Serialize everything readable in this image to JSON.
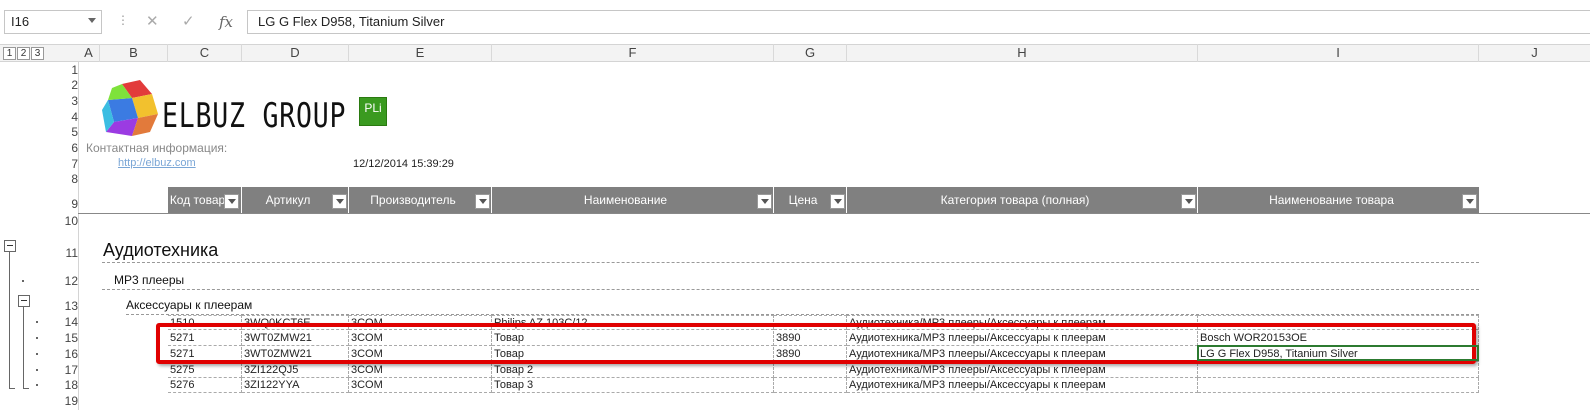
{
  "formula_bar": {
    "name_box": "I16",
    "cancel_icon": "✕",
    "enter_icon": "✓",
    "fx_icon": "fx",
    "formula": "LG G Flex D958, Titanium Silver"
  },
  "outline_levels": [
    "1",
    "2",
    "3"
  ],
  "columns": [
    "A",
    "B",
    "C",
    "D",
    "E",
    "F",
    "G",
    "H",
    "I",
    "J"
  ],
  "rows": [
    "1",
    "2",
    "3",
    "4",
    "5",
    "6",
    "7",
    "8",
    "9",
    "10",
    "11",
    "12",
    "13",
    "14",
    "15",
    "16",
    "17",
    "18",
    "19"
  ],
  "logo": {
    "brand": "ELBUZ GROUP",
    "badge": "PLi"
  },
  "contact_label": "Контактная информация:",
  "contact_link": "http://elbuz.com",
  "timestamp": "12/12/2014 15:39:29",
  "table_headers": [
    "Код товар",
    "Артикул",
    "Производитель",
    "Наименование",
    "Цена",
    "Категория товара (полная)",
    "Наименование товара"
  ],
  "group_titles": {
    "level1": "Аудиотехника",
    "level2": "MP3 плееры",
    "level3": "Аксессуары к плеерам"
  },
  "data_rows": [
    [
      "1510",
      "3WQ0KCT6E",
      "3COM",
      "Philips AZ 103C/12",
      "",
      "Аудиотехника/MP3 плееры/Аксессуары к плеерам",
      ""
    ],
    [
      "5271",
      "3WT0ZMW21",
      "3COM",
      "Товар",
      "3890",
      "Аудиотехника/MP3 плееры/Аксессуары к плеерам",
      "Bosch WOR20153OE"
    ],
    [
      "5271",
      "3WT0ZMW21",
      "3COM",
      "Товар",
      "3890",
      "Аудиотехника/MP3 плееры/Аксессуары к плеерам",
      "LG G Flex D958, Titanium Silver"
    ],
    [
      "5275",
      "3ZI122QJ5",
      "3COM",
      "Товар 2",
      "",
      "Аудиотехника/MP3 плееры/Аксессуары к плеерам",
      ""
    ],
    [
      "5276",
      "3ZI122YYA",
      "3COM",
      "Товар 3",
      "",
      "Аудиотехника/MP3 плееры/Аксессуары к плеерам",
      ""
    ]
  ],
  "colors": {
    "highlight": "#e00000",
    "header_bg": "#808080",
    "link": "#7aa6d6"
  }
}
